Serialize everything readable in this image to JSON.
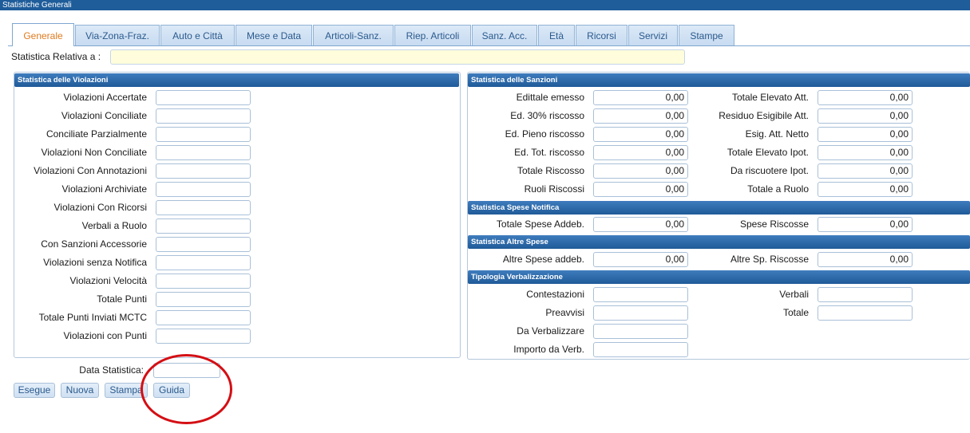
{
  "window": {
    "title": "Statistiche Generali"
  },
  "tabs": [
    "Generale",
    "Via-Zona-Fraz.",
    "Auto e Città",
    "Mese e Data",
    "Articoli-Sanz.",
    "Riep. Articoli",
    "Sanz. Acc.",
    "Età",
    "Ricorsi",
    "Servizi",
    "Stampe"
  ],
  "relativa": {
    "label": "Statistica Relativa a :",
    "value": ""
  },
  "violazioni": {
    "header": "Statistica delle Violazioni",
    "rows": [
      "Violazioni Accertate",
      "Violazioni Conciliate",
      "Conciliate Parzialmente",
      "Violazioni Non Conciliate",
      "Violazioni Con Annotazioni",
      "Violazioni Archiviate",
      "Violazioni Con Ricorsi",
      "Verbali a Ruolo",
      "Con Sanzioni Accessorie",
      "Violazioni senza Notifica",
      "Violazioni Velocità",
      "Totale Punti",
      "Totale Punti Inviati MCTC",
      "Violazioni con Punti"
    ]
  },
  "sanzioni": {
    "header": "Statistica delle Sanzioni",
    "left": [
      {
        "label": "Edittale emesso",
        "value": "0,00"
      },
      {
        "label": "Ed. 30% riscosso",
        "value": "0,00"
      },
      {
        "label": "Ed. Pieno riscosso",
        "value": "0,00"
      },
      {
        "label": "Ed. Tot. riscosso",
        "value": "0,00"
      },
      {
        "label": "Totale Riscosso",
        "value": "0,00"
      },
      {
        "label": "Ruoli Riscossi",
        "value": "0,00"
      }
    ],
    "right": [
      {
        "label": "Totale Elevato Att.",
        "value": "0,00"
      },
      {
        "label": "Residuo Esigibile Att.",
        "value": "0,00"
      },
      {
        "label": "Esig. Att. Netto",
        "value": "0,00"
      },
      {
        "label": "Totale Elevato Ipot.",
        "value": "0,00"
      },
      {
        "label": "Da riscuotere Ipot.",
        "value": "0,00"
      },
      {
        "label": "Totale a Ruolo",
        "value": "0,00"
      }
    ]
  },
  "spese_notifica": {
    "header": "Statistica Spese Notifica",
    "left": {
      "label": "Totale Spese Addeb.",
      "value": "0,00"
    },
    "right": {
      "label": "Spese Riscosse",
      "value": "0,00"
    }
  },
  "altre_spese": {
    "header": "Statistica Altre Spese",
    "left": {
      "label": "Altre Spese addeb.",
      "value": "0,00"
    },
    "right": {
      "label": "Altre Sp. Riscosse",
      "value": "0,00"
    }
  },
  "tipologia": {
    "header": "Tipologia Verbalizzazione",
    "left": [
      "Contestazioni",
      "Preavvisi",
      "Da Verbalizzare",
      "Importo da Verb."
    ],
    "right": [
      "Verbali",
      "Totale"
    ]
  },
  "data_statistica": {
    "label": "Data Statistica:",
    "value": ""
  },
  "buttons": {
    "esegue": "Esegue",
    "nuova": "Nuova",
    "stampa": "Stampa",
    "guida": "Guida"
  },
  "annotation": {
    "color": "#d40f14"
  }
}
